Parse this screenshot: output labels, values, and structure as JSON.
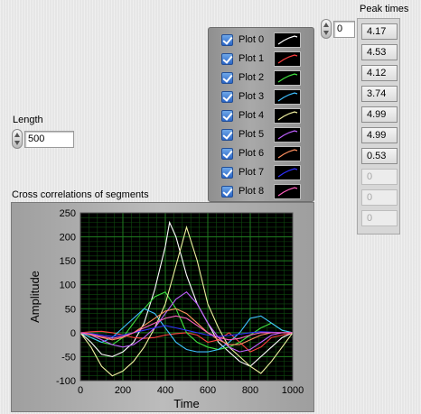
{
  "length": {
    "label": "Length",
    "value": "500"
  },
  "legend": {
    "items": [
      {
        "label": "Plot 0",
        "color": "#ffffff",
        "checked": true
      },
      {
        "label": "Plot 1",
        "color": "#ff4040",
        "checked": true
      },
      {
        "label": "Plot 2",
        "color": "#40e040",
        "checked": true
      },
      {
        "label": "Plot 3",
        "color": "#40c0ff",
        "checked": true
      },
      {
        "label": "Plot 4",
        "color": "#f0f0a0",
        "checked": true
      },
      {
        "label": "Plot 5",
        "color": "#c060ff",
        "checked": true
      },
      {
        "label": "Plot 6",
        "color": "#ff9060",
        "checked": true
      },
      {
        "label": "Plot 7",
        "color": "#3030ff",
        "checked": true
      },
      {
        "label": "Plot 8",
        "color": "#ff60c0",
        "checked": true
      }
    ]
  },
  "peak_times": {
    "label": "Peak times",
    "index_value": "0",
    "values": [
      "4.17",
      "4.53",
      "4.12",
      "3.74",
      "4.99",
      "4.99",
      "0.53",
      "0",
      "0",
      "0"
    ]
  },
  "graph": {
    "title": "Cross correlations of segments",
    "background": "#000000",
    "grid_color": "#1f7a1f"
  },
  "chart_data": {
    "type": "line",
    "title": "Cross correlations of segments",
    "xlabel": "Time",
    "ylabel": "Amplitude",
    "xlim": [
      0,
      1000
    ],
    "ylim": [
      -100,
      250
    ],
    "x_ticks": [
      "0",
      "200",
      "400",
      "600",
      "800",
      "1000"
    ],
    "y_ticks": [
      "250",
      "200",
      "150",
      "100",
      "50",
      "0",
      "-50",
      "-100"
    ],
    "grid": true,
    "legend": "right",
    "series": [
      {
        "name": "Plot 0",
        "color": "#ffffff",
        "x": [
          0,
          50,
          100,
          150,
          200,
          250,
          300,
          350,
          400,
          420,
          450,
          500,
          550,
          600,
          650,
          700,
          750,
          800,
          850,
          900,
          950,
          1000
        ],
        "y": [
          0,
          -20,
          -45,
          -50,
          -40,
          -20,
          20,
          90,
          180,
          230,
          200,
          120,
          60,
          20,
          -20,
          -40,
          -60,
          -70,
          -50,
          -30,
          -10,
          0
        ]
      },
      {
        "name": "Plot 1",
        "color": "#ff4040",
        "x": [
          0,
          50,
          100,
          150,
          200,
          250,
          300,
          350,
          400,
          450,
          500,
          550,
          600,
          650,
          700,
          750,
          800,
          850,
          900,
          950,
          1000
        ],
        "y": [
          0,
          2,
          3,
          0,
          -5,
          -10,
          -12,
          -10,
          -5,
          -2,
          0,
          -5,
          -20,
          -15,
          0,
          -20,
          -40,
          -30,
          -10,
          -5,
          0
        ]
      },
      {
        "name": "Plot 2",
        "color": "#40e040",
        "x": [
          0,
          50,
          100,
          150,
          200,
          250,
          300,
          350,
          400,
          450,
          500,
          550,
          600,
          650,
          700,
          750,
          800,
          850,
          900,
          950,
          1000
        ],
        "y": [
          0,
          -10,
          -20,
          -25,
          -10,
          20,
          50,
          75,
          85,
          50,
          0,
          -20,
          -30,
          -35,
          -30,
          -20,
          -5,
          10,
          20,
          5,
          0
        ]
      },
      {
        "name": "Plot 3",
        "color": "#40c0ff",
        "x": [
          0,
          50,
          100,
          150,
          200,
          250,
          300,
          350,
          400,
          450,
          500,
          550,
          600,
          650,
          700,
          750,
          800,
          850,
          900,
          950,
          1000
        ],
        "y": [
          0,
          -10,
          -20,
          -10,
          10,
          30,
          50,
          40,
          10,
          -20,
          -35,
          -40,
          -40,
          -35,
          -20,
          0,
          30,
          35,
          20,
          5,
          0
        ]
      },
      {
        "name": "Plot 4",
        "color": "#f0f0a0",
        "x": [
          0,
          50,
          100,
          150,
          200,
          250,
          300,
          350,
          400,
          450,
          500,
          550,
          600,
          650,
          700,
          750,
          800,
          850,
          900,
          950,
          1000
        ],
        "y": [
          0,
          -30,
          -70,
          -90,
          -80,
          -60,
          -30,
          10,
          60,
          140,
          220,
          150,
          60,
          10,
          -30,
          -50,
          -70,
          -85,
          -60,
          -30,
          0
        ]
      },
      {
        "name": "Plot 5",
        "color": "#c060ff",
        "x": [
          0,
          50,
          100,
          150,
          200,
          250,
          300,
          350,
          400,
          450,
          500,
          550,
          600,
          650,
          700,
          750,
          800,
          850,
          900,
          950,
          1000
        ],
        "y": [
          0,
          -5,
          -15,
          -25,
          -30,
          -25,
          -10,
          10,
          40,
          70,
          85,
          60,
          20,
          -10,
          -30,
          -40,
          -35,
          -20,
          -5,
          0,
          0
        ]
      },
      {
        "name": "Plot 6",
        "color": "#ff9060",
        "x": [
          0,
          50,
          100,
          150,
          200,
          250,
          300,
          350,
          400,
          450,
          500,
          550,
          600,
          650,
          700,
          750,
          800,
          850,
          900,
          950,
          1000
        ],
        "y": [
          0,
          -5,
          -10,
          -15,
          -10,
          0,
          15,
          30,
          45,
          50,
          40,
          20,
          0,
          -15,
          -25,
          -25,
          -15,
          -5,
          0,
          0,
          0
        ]
      },
      {
        "name": "Plot 7",
        "color": "#3030ff",
        "x": [
          0,
          50,
          100,
          150,
          200,
          250,
          300,
          350,
          400,
          450,
          500,
          550,
          600,
          650,
          700,
          750,
          800,
          850,
          900,
          950,
          1000
        ],
        "y": [
          0,
          -2,
          -5,
          -8,
          -5,
          0,
          5,
          10,
          15,
          10,
          5,
          0,
          -5,
          -8,
          -6,
          -3,
          0,
          2,
          1,
          0,
          0
        ]
      },
      {
        "name": "Plot 8",
        "color": "#ff60c0",
        "x": [
          0,
          50,
          100,
          150,
          200,
          250,
          300,
          350,
          400,
          450,
          500,
          550,
          600,
          650,
          700,
          750,
          800,
          850,
          900,
          950,
          1000
        ],
        "y": [
          0,
          -3,
          -8,
          -12,
          -8,
          0,
          10,
          20,
          30,
          35,
          30,
          15,
          0,
          -10,
          -15,
          -12,
          -5,
          0,
          0,
          0,
          0
        ]
      }
    ]
  }
}
